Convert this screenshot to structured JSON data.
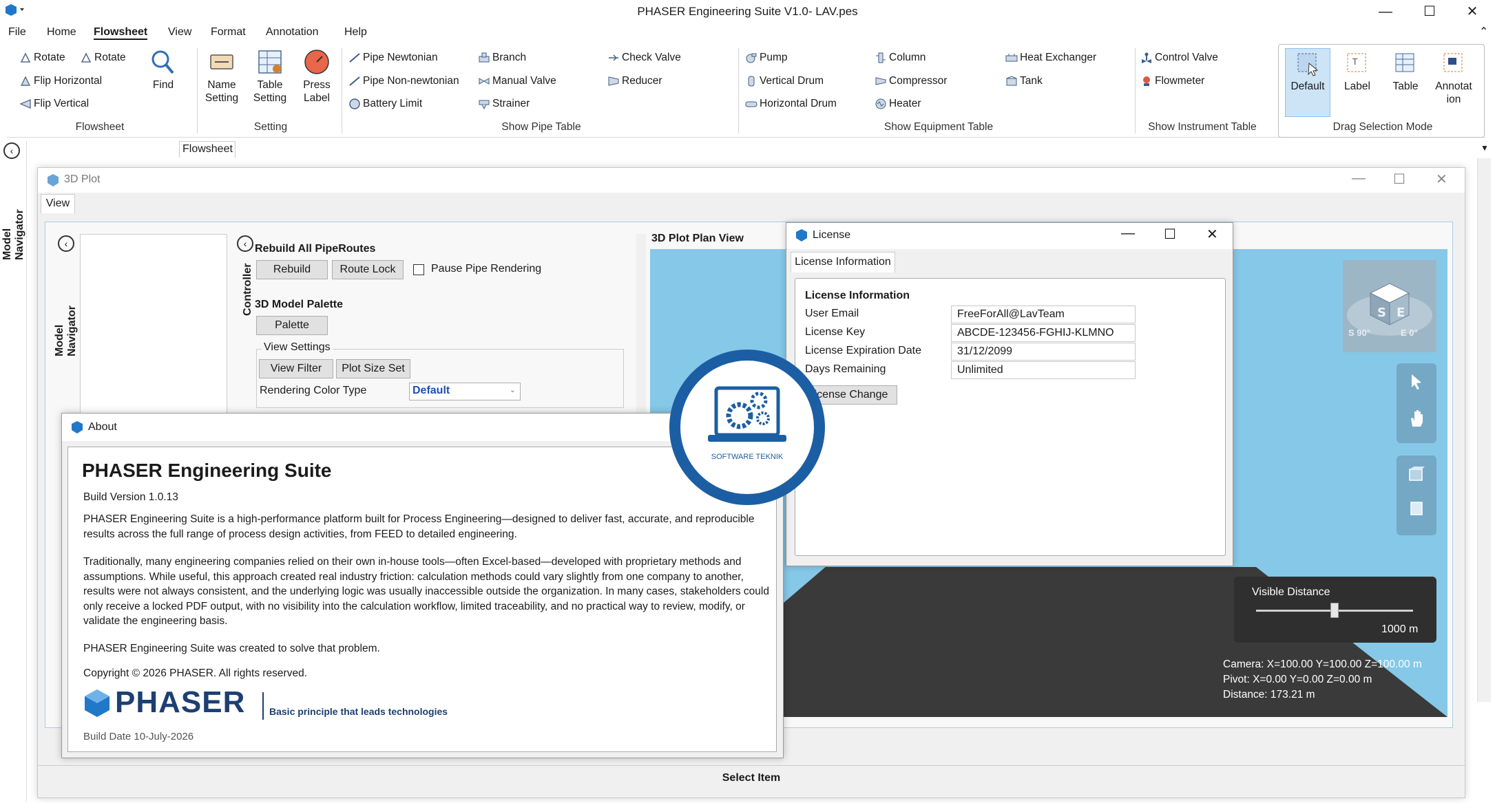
{
  "window": {
    "title": "PHASER Engineering Suite V1.0- LAV.pes",
    "controls": [
      "—",
      "☐",
      "✕"
    ]
  },
  "menu": [
    "File",
    "Home",
    "Flowsheet",
    "View",
    "Format",
    "Annotation",
    "Help"
  ],
  "ribbon": {
    "flowsheet": {
      "rotate1": "Rotate",
      "rotate2": "Rotate",
      "flip_h": "Flip Horizontal",
      "flip_v": "Flip Vertical",
      "find": "Find",
      "group": "Flowsheet"
    },
    "setting": {
      "name_setting": "Name Setting",
      "table_setting": "Table Setting",
      "press_label": "Press Label",
      "group": "Setting"
    },
    "pipe": {
      "pipe_newtonian": "Pipe Newtonian",
      "pipe_non_newtonian": "Pipe Non-newtonian",
      "battery_limit": "Battery Limit",
      "branch": "Branch",
      "manual_valve": "Manual Valve",
      "strainer": "Strainer",
      "check_valve": "Check Valve",
      "reducer": "Reducer",
      "group": "Show Pipe Table"
    },
    "equipment": {
      "pump": "Pump",
      "vertical_drum": "Vertical Drum",
      "horizontal_drum": "Horizontal Drum",
      "column": "Column",
      "compressor": "Compressor",
      "heater": "Heater",
      "heat_exchanger": "Heat Exchanger",
      "tank": "Tank",
      "group": "Show Equipment Table"
    },
    "instrument": {
      "control_valve": "Control Valve",
      "flowmeter": "Flowmeter",
      "group": "Show Instrument Table"
    },
    "drag": {
      "default": "Default",
      "label": "Label",
      "table": "Table",
      "annotation_1": "Annotat",
      "annotation_2": "ion",
      "group": "Drag Selection Mode"
    }
  },
  "left_nav": {
    "title": "Model Navigator"
  },
  "doc_tab": "Flowsheet",
  "plot_window": {
    "title": "3D Plot",
    "view_tab": "View",
    "model_navigator": "Model Navigator",
    "controller": "Controller",
    "rebuild_all": "Rebuild All PipeRoutes",
    "rebuild_btn": "Rebuild",
    "route_lock_btn": "Route Lock",
    "pause_label": "Pause Pipe Rendering",
    "palette_title": "3D Model Palette",
    "palette_btn": "Palette",
    "view_settings": "View Settings",
    "view_filter_btn": "View Filter",
    "plot_size_btn": "Plot Size Set",
    "rendering_color_label": "Rendering Color Type",
    "rendering_color_value": "Default",
    "plan_view_title": "3D Plot Plan View",
    "visible_distance_label": "Visible Distance",
    "visible_distance_value": "1000 m",
    "visible_distance_level": 0.5,
    "camera": "Camera: X=100.00  Y=100.00  Z=100.00 m",
    "pivot": "Pivot: X=0.00  Y=0.00  Z=0.00 m",
    "distance": "Distance: 173.21 m",
    "cube_s": "S 90°",
    "cube_e": "E 0°",
    "status": "Select Item"
  },
  "license": {
    "title": "License",
    "tab": "License Information",
    "heading": "License Information",
    "fields": [
      {
        "label": "User Email",
        "value": "FreeForAll@LavTeam"
      },
      {
        "label": "License Key",
        "value": "ABCDE-123456-FGHIJ-KLMNO"
      },
      {
        "label": "License Expiration Date",
        "value": "31/12/2099"
      },
      {
        "label": "Days Remaining",
        "value": "Unlimited"
      }
    ],
    "change_btn": "icense Change"
  },
  "about": {
    "title": "About",
    "product": "PHASER Engineering Suite",
    "build_version": "Build Version 1.0.13",
    "para1": "PHASER Engineering Suite is a high-performance platform built for Process Engineering—designed to deliver fast, accurate, and reproducible results across the full range of process design activities, from FEED to detailed engineering.",
    "para2": "Traditionally, many engineering companies relied on their own in-house tools—often Excel-based—developed with proprietary methods and assumptions. While useful, this approach created real industry friction: calculation methods could vary slightly from one company to another, results were not always consistent, and the underlying logic was usually inaccessible outside the organization. In many cases, stakeholders could only receive a locked PDF output, with no visibility into the calculation workflow, limited traceability, and no practical way to review, modify, or validate the engineering basis.",
    "para3": "PHASER Engineering Suite was created to solve that problem.",
    "copyright": "Copyright © 2026 PHASER. All rights reserved.",
    "logo_text": "PHASER",
    "tagline": "Basic principle that leads technologies",
    "build_date": "Build Date 10-July-2026"
  },
  "watermark": {
    "text": "SOFTWARE  TEKNIK"
  }
}
